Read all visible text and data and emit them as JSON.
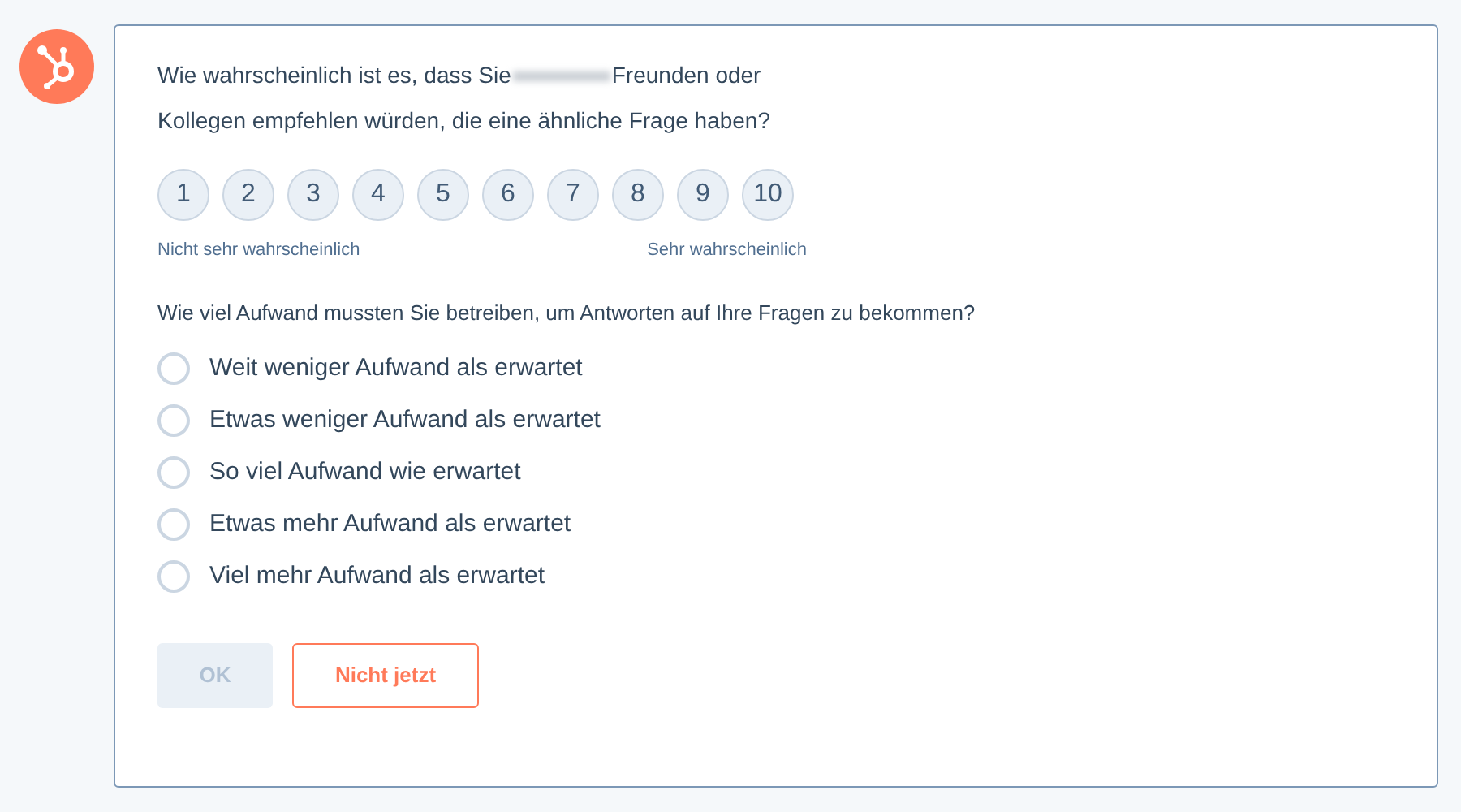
{
  "nps": {
    "question_start": "Wie wahrscheinlich ist es, dass Sie",
    "question_end": "Freunden oder Kollegen empfehlen würden, die eine ähnliche Frage haben?",
    "scale": [
      {
        "label": "1",
        "selected": false
      },
      {
        "label": "2",
        "selected": false
      },
      {
        "label": "3",
        "selected": false
      },
      {
        "label": "4",
        "selected": false
      },
      {
        "label": "5",
        "selected": false
      },
      {
        "label": "6",
        "selected": false
      },
      {
        "label": "7",
        "selected": false
      },
      {
        "label": "8",
        "selected": false
      },
      {
        "label": "9",
        "selected": false
      },
      {
        "label": "10",
        "selected": false
      }
    ],
    "low_label": "Nicht sehr wahrscheinlich",
    "high_label": "Sehr wahrscheinlich"
  },
  "effort": {
    "question": "Wie viel Aufwand mussten Sie betreiben, um Antworten auf Ihre Fragen zu bekommen?",
    "options": [
      {
        "label": "Weit weniger Aufwand als erwartet",
        "selected": false
      },
      {
        "label": "Etwas weniger Aufwand als erwartet",
        "selected": false
      },
      {
        "label": "So viel Aufwand wie erwartet",
        "selected": false
      },
      {
        "label": "Etwas mehr Aufwand als erwartet",
        "selected": false
      },
      {
        "label": "Viel mehr Aufwand als erwartet",
        "selected": false
      }
    ]
  },
  "buttons": [
    {
      "label": "OK",
      "kind": "primary",
      "disabled": true
    },
    {
      "label": "Nicht jetzt",
      "kind": "secondary",
      "disabled": false
    }
  ]
}
